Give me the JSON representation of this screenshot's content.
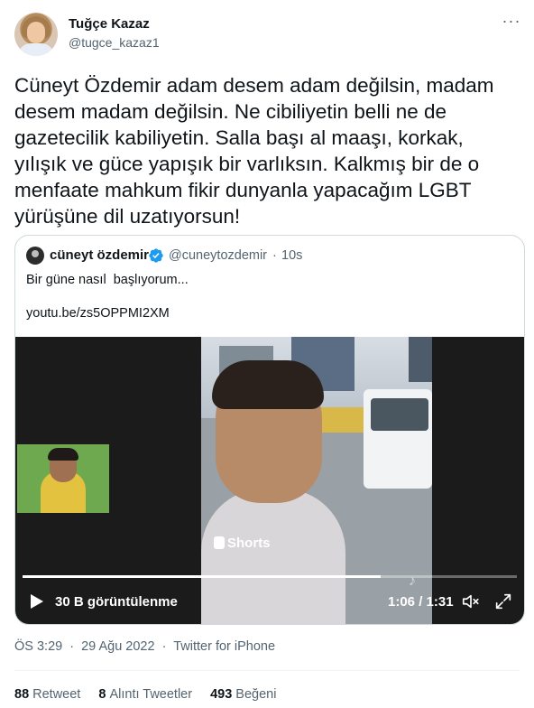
{
  "author": {
    "display_name": "Tuğçe Kazaz",
    "handle": "@tugce_kazaz1"
  },
  "more_icon": "more-horizontal-icon",
  "tweet_text": "Cüneyt Özdemir adam desem adam değilsin, madam desem madam değilsin. Ne cibiliyetin belli ne de gazetecilik kabiliyetin. Salla başı al maaşı, korkak, yılışık ve güce yapışık bir varlıksın. Kalkmış bir de o menfaate mahkum fikir dunyanla yapacağım LGBT yürüşüne dil uzatıyorsun!",
  "quoted": {
    "display_name": "cüneyt özdemir",
    "verified_icon": "verified-badge-icon",
    "handle": "@cuneytozdemir",
    "separator": "·",
    "time": "10s",
    "line1": "Bir güne nasıl  başlıyorum...",
    "line2": "youtu.be/zs5OPPMI2XM",
    "video": {
      "watermark": "Shorts",
      "views": "30 B görüntülenme",
      "time": "1:06 / 1:31",
      "progress": 0.725,
      "play_icon": "play-icon",
      "volume_icon": "volume-muted-icon",
      "fullscreen_icon": "fullscreen-icon"
    }
  },
  "meta": {
    "time": "ÖS 3:29",
    "dot1": "·",
    "date": "29 Ağu 2022",
    "dot2": "·",
    "source": "Twitter for iPhone"
  },
  "stats": {
    "retweets_count": "88",
    "retweets_label": "Retweet",
    "quotes_count": "8",
    "quotes_label": "Alıntı Tweetler",
    "likes_count": "493",
    "likes_label": "Beğeni"
  },
  "colors": {
    "text": "#0f1419",
    "secondary": "#536471",
    "border": "#cfd9de",
    "verified": "#1d9bf0"
  }
}
